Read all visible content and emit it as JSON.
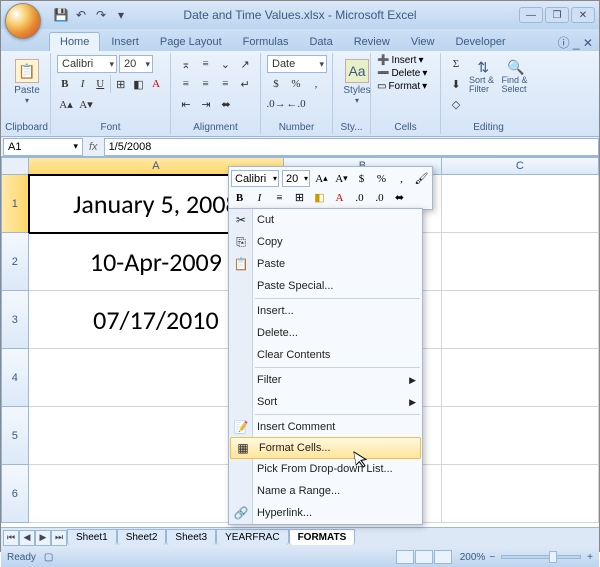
{
  "window": {
    "title": "Date and Time Values.xlsx - Microsoft Excel"
  },
  "ribbon": {
    "tabs": [
      "Home",
      "Insert",
      "Page Layout",
      "Formulas",
      "Data",
      "Review",
      "View",
      "Developer"
    ],
    "active_tab": "Home",
    "groups": {
      "clipboard": {
        "label": "Clipboard",
        "paste": "Paste"
      },
      "font": {
        "label": "Font",
        "name": "Calibri",
        "size": "20",
        "bold": "B",
        "italic": "I",
        "underline": "U"
      },
      "alignment": {
        "label": "Alignment"
      },
      "number": {
        "label": "Number",
        "format": "Date"
      },
      "styles": {
        "label": "Sty...",
        "btn": "Styles"
      },
      "cells": {
        "label": "Cells",
        "insert": "Insert",
        "delete": "Delete",
        "format": "Format"
      },
      "editing": {
        "label": "Editing",
        "sort": "Sort & Filter",
        "find": "Find & Select"
      }
    }
  },
  "formula_bar": {
    "name_box": "A1",
    "fx": "fx",
    "value": "1/5/2008"
  },
  "columns": {
    "A": "A",
    "B": "B",
    "C": "C"
  },
  "rows": [
    "1",
    "2",
    "3",
    "4",
    "5",
    "6"
  ],
  "cells": {
    "A1": "January 5, 2008",
    "A2": "10-Apr-2009",
    "A3": "07/17/2010"
  },
  "mini_toolbar": {
    "font": "Calibri",
    "size": "20",
    "grow": "A",
    "shrink": "A",
    "currency": "$",
    "percent": "%",
    "comma": ",",
    "bold": "B",
    "italic": "I"
  },
  "context_menu": {
    "cut": "Cut",
    "copy": "Copy",
    "paste": "Paste",
    "paste_special": "Paste Special...",
    "insert": "Insert...",
    "delete": "Delete...",
    "clear": "Clear Contents",
    "filter": "Filter",
    "sort": "Sort",
    "comment": "Insert Comment",
    "format_cells": "Format Cells...",
    "pick": "Pick From Drop-down List...",
    "name": "Name a Range...",
    "hyperlink": "Hyperlink..."
  },
  "sheets": {
    "s1": "Sheet1",
    "s2": "Sheet2",
    "s3": "Sheet3",
    "s4": "YEARFRAC",
    "s5": "FORMATS"
  },
  "status": {
    "ready": "Ready",
    "zoom": "200%"
  }
}
